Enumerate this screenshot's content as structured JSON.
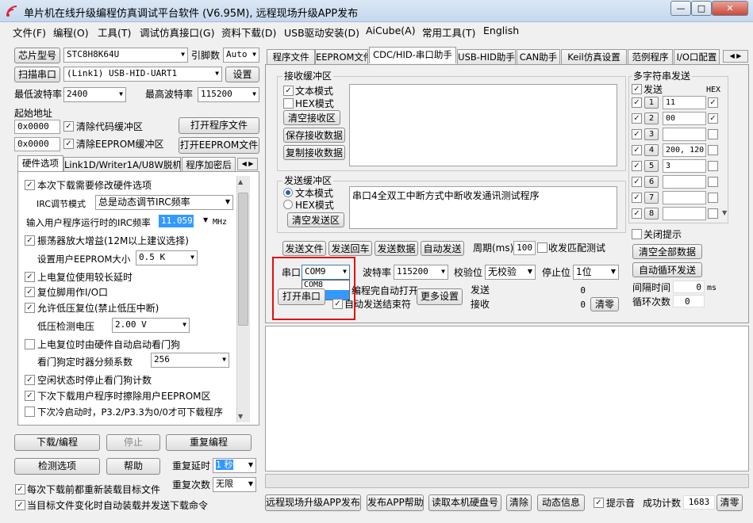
{
  "window": {
    "title": "单片机在线升级编程仿真调试平台软件 (V6.95M), 远程现场升级APP发布",
    "min": "—",
    "max": "□",
    "close": "✕"
  },
  "menu": [
    "文件(F)",
    "编程(O)",
    "工具(T)",
    "调试仿真接口(G)",
    "资料下载(D)",
    "USB驱动安装(D)",
    "AiCube(A)",
    "常用工具(T)",
    "English"
  ],
  "left": {
    "chip_label": "芯片型号",
    "chip_value": "STC8H8K64U",
    "pin_label": "引脚数",
    "pin_value": "Auto",
    "scan_label": "扫描串口",
    "port_value": "(Link1) USB-HID-UART1",
    "settings": "设置",
    "min_baud_label": "最低波特率",
    "min_baud": "2400",
    "max_baud_label": "最高波特率",
    "max_baud": "115200",
    "start_addr_label": "起始地址",
    "addr1": "0x0000",
    "clear_code": "清除代码缓冲区",
    "open_prog": "打开程序文件",
    "addr2": "0x0000",
    "clear_eeprom": "清除EEPROM缓冲区",
    "open_eeprom": "打开EEPROM文件",
    "tabs": [
      "硬件选项",
      "Link1D/Writer1A/U8W脱机",
      "程序加密后"
    ],
    "hw": {
      "o1": "本次下载需要修改硬件选项",
      "irc_label": "IRC调节模式",
      "irc_value": "总是动态调节IRC频率",
      "freq_label": "输入用户程序运行时的IRC频率",
      "freq_value": "11.0592",
      "freq_unit": "MHz",
      "o2": "振荡器放大增益(12M以上建议选择)",
      "eeprom_label": "设置用户EEPROM大小",
      "eeprom_value": "0.5 K",
      "o3": "上电复位使用较长延时",
      "o4": "复位脚用作I/O口",
      "o5": "允许低压复位(禁止低压中断)",
      "lv_label": "低压检测电压",
      "lv_value": "2.00 V",
      "o6": "上电复位时由硬件自动启动看门狗",
      "wdt_label": "看门狗定时器分频系数",
      "wdt_value": "256",
      "o7": "空闲状态时停止看门狗计数",
      "o8": "下次下载用户程序时擦除用户EEPROM区",
      "o9": "下次冷启动时，P3.2/P3.3为0/0才可下载程序"
    },
    "download": "下载/编程",
    "stop": "停止",
    "reprog": "重复编程",
    "detect": "检测选项",
    "help": "帮助",
    "delay_label": "重复延时",
    "delay_value": "1 秒",
    "count_label": "重复次数",
    "count_value": "无限",
    "reload": "每次下载前都重新装载目标文件",
    "autoload": "当目标文件变化时自动装载并发送下载命令"
  },
  "right": {
    "tabs": [
      "程序文件",
      "EEPROM文件",
      "CDC/HID-串口助手",
      "USB-HID助手",
      "CAN助手",
      "Keil仿真设置",
      "范例程序",
      "I/O口配置"
    ],
    "recv": {
      "title": "接收缓冲区",
      "text_mode": "文本模式",
      "hex_mode": "HEX模式",
      "clear": "清空接收区",
      "save": "保存接收数据",
      "copy": "复制接收数据"
    },
    "send": {
      "title": "发送缓冲区",
      "text_mode": "文本模式",
      "hex_mode": "HEX模式",
      "clear": "清空发送区",
      "content": "串口4全双工中断方式中断收发通讯测试程序"
    },
    "actions": {
      "send_file": "发送文件",
      "send_enter": "发送回车",
      "send_data": "发送数据",
      "auto_send": "自动发送",
      "period_label": "周期(ms)",
      "period": "100",
      "match": "收发匹配测试"
    },
    "multi": {
      "title": "多字符串发送",
      "send": "发送",
      "hex": "HEX",
      "rows": [
        {
          "n": "1",
          "v": "11"
        },
        {
          "n": "2",
          "v": "00"
        },
        {
          "n": "3",
          "v": ""
        },
        {
          "n": "4",
          "v": "200, 120,"
        },
        {
          "n": "5",
          "v": "3"
        },
        {
          "n": "6",
          "v": ""
        },
        {
          "n": "7",
          "v": ""
        },
        {
          "n": "8",
          "v": ""
        }
      ],
      "hide": "关闭提示",
      "clear_all": "清空全部数据",
      "loop": "自动循环发送",
      "interval_label": "间隔时间",
      "interval": "0",
      "interval_unit": "ms",
      "loops_label": "循环次数",
      "loops": "0"
    },
    "serial": {
      "port_label": "串口",
      "port_value": "COM9",
      "options": [
        "COM8",
        "COM9"
      ],
      "baud_label": "波特率",
      "baud": "115200",
      "parity_label": "校验位",
      "parity": "无校验",
      "stop_label": "停止位",
      "stop": "1位",
      "open": "打开串口",
      "auto_open": "编程完自动打开",
      "auto_close": "自动发送结束符",
      "more": "更多设置",
      "tx_label": "发送",
      "tx": "0",
      "rx_label": "接收",
      "rx": "0",
      "clear": "清零"
    },
    "bottom": {
      "remote": "远程现场升级APP发布",
      "publish_help": "发布APP帮助",
      "read_id": "读取本机硬盘号",
      "clear": "清除",
      "anim": "动态信息",
      "beep": "提示音",
      "success_label": "成功计数",
      "success": "1683",
      "reset": "清零"
    }
  },
  "colors": {
    "highlight_box": "#e01010",
    "selection": "#3399ff"
  }
}
